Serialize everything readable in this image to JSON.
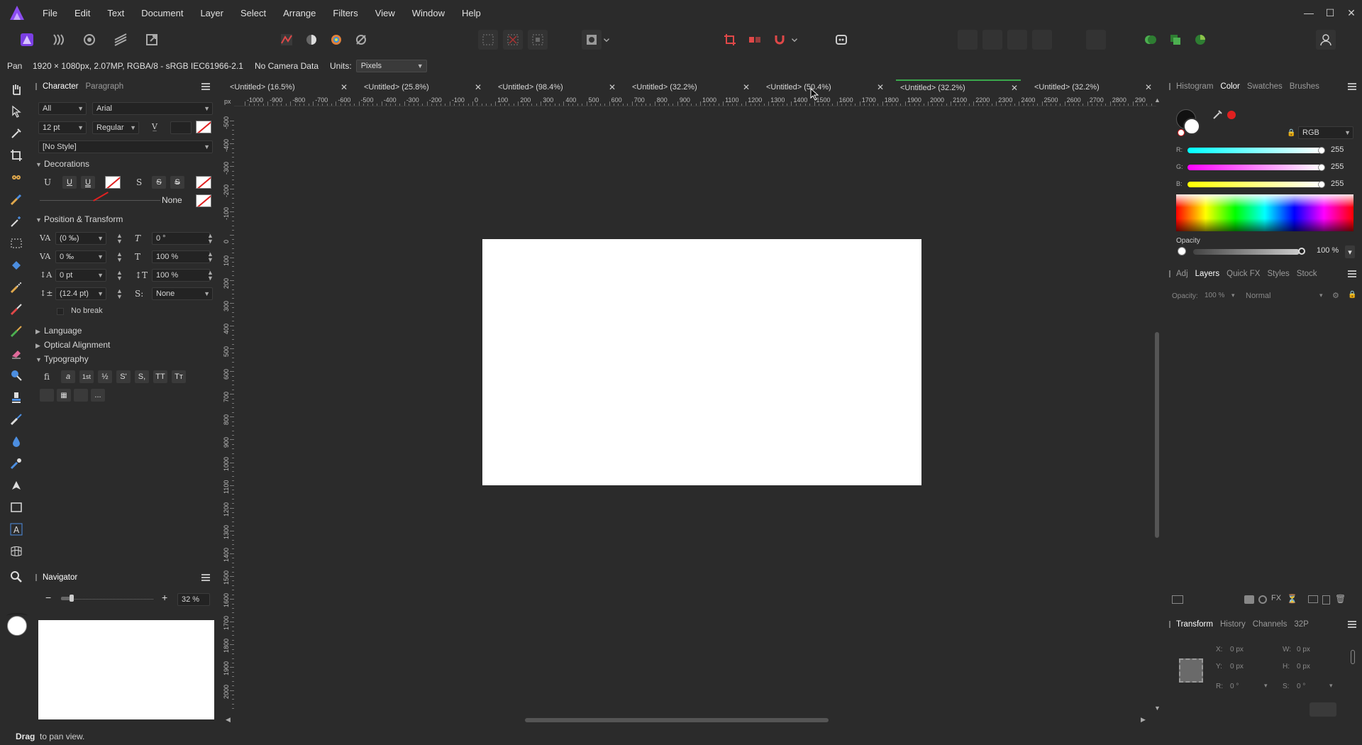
{
  "menu": [
    "File",
    "Edit",
    "Text",
    "Document",
    "Layer",
    "Select",
    "Arrange",
    "Filters",
    "View",
    "Window",
    "Help"
  ],
  "window_controls": [
    "—",
    "☐",
    "✕"
  ],
  "context": {
    "tool": "Pan",
    "doc_info": "1920 × 1080px, 2.07MP, RGBA/8 - sRGB IEC61966-2.1",
    "camera": "No Camera Data",
    "units_label": "Units:",
    "units_value": "Pixels"
  },
  "character_panel": {
    "tabs": [
      "Character",
      "Paragraph"
    ],
    "scope": "All",
    "font": "Arial",
    "size": "12 pt",
    "weight": "Regular",
    "style": "[No Style]",
    "decorations_title": "Decorations",
    "line_none": "None",
    "position_title": "Position & Transform",
    "kerning": "(0 ‰)",
    "tracking": "0 ‰",
    "baseline": "0 pt",
    "leading": "(12.4 pt)",
    "skew": "0 °",
    "vscale": "100 %",
    "hscale": "100 %",
    "script": "None",
    "no_break": "No break",
    "language": "Language",
    "optical": "Optical Alignment",
    "typography": "Typography",
    "typo_buttons": [
      "fi",
      "a",
      "1st",
      "½",
      "S'",
      "S,",
      "TT",
      "Tт"
    ],
    "typo_more": "..."
  },
  "navigator": {
    "title": "Navigator",
    "zoom": "32 %"
  },
  "doc_tabs": [
    {
      "label": "<Untitled> (16.5%)"
    },
    {
      "label": "<Untitled> (25.8%)"
    },
    {
      "label": "<Untitled> (98.4%)"
    },
    {
      "label": "<Untitled> (32.2%)"
    },
    {
      "label": "<Untitled> (50.4%)"
    },
    {
      "label": "<Untitled> (32.2%)",
      "active": true
    },
    {
      "label": "<Untitled> (32.2%)"
    }
  ],
  "ruler_unit": "px",
  "ruler_top": [
    "-1000",
    "-900",
    "-800",
    "-700",
    "-600",
    "-500",
    "-400",
    "-300",
    "-200",
    "-100",
    "0",
    "100",
    "200",
    "300",
    "400",
    "500",
    "600",
    "700",
    "800",
    "900",
    "1000",
    "1100",
    "1200",
    "1300",
    "1400",
    "1500",
    "1600",
    "1700",
    "1800",
    "1900",
    "2000",
    "2100",
    "2200",
    "2300",
    "2400",
    "2500",
    "2600",
    "2700",
    "2800",
    "290"
  ],
  "ruler_left": [
    "-500",
    "-400",
    "-300",
    "-200",
    "-100",
    "0",
    "100",
    "200",
    "300",
    "400",
    "500",
    "600",
    "700",
    "800",
    "900",
    "1000",
    "1100",
    "1200",
    "1300",
    "1400",
    "1500",
    "1600",
    "1700",
    "1800",
    "1900",
    "2000"
  ],
  "color_panel": {
    "tabs": [
      "Histogram",
      "Color",
      "Swatches",
      "Brushes"
    ],
    "active_tab": "Color",
    "model": "RGB",
    "r_label": "R:",
    "r": "255",
    "g_label": "G:",
    "g": "255",
    "b_label": "B:",
    "b": "255",
    "opacity_label": "Opacity",
    "opacity": "100 %"
  },
  "layers_panel": {
    "tabs": [
      "Adj",
      "Layers",
      "Quick FX",
      "Styles",
      "Stock"
    ],
    "opacity_label": "Opacity:",
    "opacity": "100 %",
    "blend": "Normal"
  },
  "transform_panel": {
    "tabs": [
      "Transform",
      "History",
      "Channels",
      "32P"
    ],
    "x_label": "X:",
    "x": "0 px",
    "y_label": "Y:",
    "y": "0 px",
    "w_label": "W:",
    "w": "0 px",
    "h_label": "H:",
    "h": "0 px",
    "r_label": "R:",
    "r": "0 °",
    "s_label": "S:",
    "s": "0 °"
  },
  "status": {
    "bold": "Drag",
    "text": "to pan view."
  },
  "colors": {
    "accent_green": "#3aa84c",
    "background": "#2b2b2b",
    "brand": "#7b3fe4"
  }
}
